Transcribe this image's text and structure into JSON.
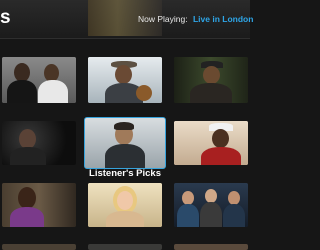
{
  "header": {
    "title_fragment": "s",
    "now_playing_label": "Now Playing:",
    "now_playing_value": "Live in London"
  },
  "section": {
    "label": "Listener's Picks"
  },
  "tiles": [
    {
      "name": "artist-tile-1",
      "icon": "artist-duo-portrait"
    },
    {
      "name": "artist-tile-2",
      "icon": "guitarist-hat-portrait"
    },
    {
      "name": "artist-tile-3",
      "icon": "cap-artist-portrait"
    },
    {
      "name": "artist-tile-4",
      "icon": "dark-portrait"
    },
    {
      "name": "artist-tile-5",
      "icon": "male-singer-portrait",
      "selected": true
    },
    {
      "name": "artist-tile-6",
      "icon": "white-cap-portrait"
    },
    {
      "name": "artist-tile-7",
      "icon": "female-singer-portrait"
    },
    {
      "name": "artist-tile-8",
      "icon": "blonde-singer-portrait"
    },
    {
      "name": "artist-tile-9",
      "icon": "band-group-portrait"
    }
  ],
  "colors": {
    "accent": "#2ea6e8",
    "selection": "#36a3dc",
    "background": "#161616"
  }
}
